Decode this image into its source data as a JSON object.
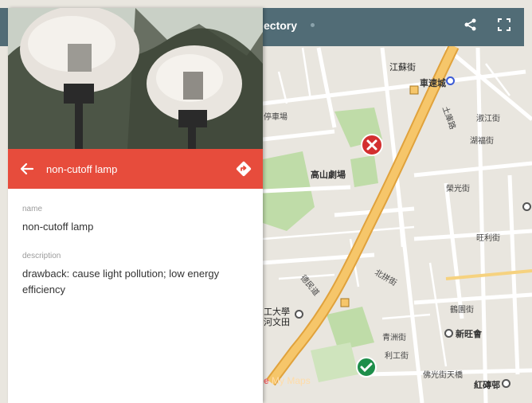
{
  "map": {
    "title": "ectory",
    "attribution_prefix": "e",
    "attribution": "My Maps",
    "labels": {
      "l1": "江蘇街",
      "l2": "車速城",
      "l3": "停車場",
      "l4": "高山劇場",
      "l5": "淑江街",
      "l6": "湖福街",
      "l7": "土庫路",
      "l8": "榮光街",
      "l9": "旺利街",
      "l10": "北拼街",
      "l11": "工大學",
      "l12": "河文田",
      "l13": "青洲街",
      "l14": "新旺會",
      "l15": "利工街",
      "l16": "佛光街天橋",
      "l17": "紅磚邨",
      "l18": "鶴園街",
      "l19": "德民道"
    },
    "colors": {
      "topbar": "#516c76",
      "highway": "#f2b44d",
      "park": "#bfdca8",
      "marker_red": "#d32f2f",
      "marker_green": "#1e8e4a"
    }
  },
  "panel": {
    "header_title": "non-cutoff lamp",
    "header_color": "#e74c3c",
    "fields": [
      {
        "label": "name",
        "value": "non-cutoff lamp"
      },
      {
        "label": "description",
        "value": "drawback: cause light pollution; low energy efficiency"
      }
    ]
  },
  "icons": [
    "share-icon",
    "fullscreen-icon",
    "back-arrow-icon",
    "directions-icon",
    "close-marker-icon",
    "check-marker-icon"
  ]
}
